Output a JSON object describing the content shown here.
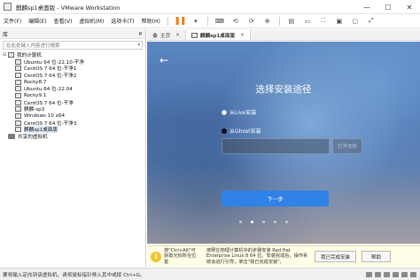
{
  "window": {
    "title": "麒麟sp1桌面版 - VMware Workstation",
    "min": "—",
    "max": "☐",
    "close": "✕"
  },
  "menu": [
    "文件(F)",
    "编辑(E)",
    "查看(V)",
    "虚拟机(M)",
    "选项卡(T)",
    "帮助(H)"
  ],
  "library": {
    "title": "库",
    "close": "✕",
    "search_placeholder": "在此处键入内容进行搜索",
    "root": "我的计算机",
    "vms": [
      "Ubuntu 64 位-22.10-干净",
      "CentOS 7 64 位-干净1",
      "CentOS 7 64 位-干净2",
      "Rocky8.7",
      "Ubuntu 64 位-22.04",
      "Rocky9.1",
      "CentOS 7 64 位-干净",
      "麒麟-sp3",
      "Windows 10 x64",
      "CentOS 7 64 位-干净3",
      "麒麟sp1桌面版"
    ],
    "shared": "共享的虚拟机"
  },
  "tabs": [
    {
      "label": "主页",
      "close": "✕"
    },
    {
      "label": "麒麟sp1桌面版",
      "close": "✕"
    }
  ],
  "installer": {
    "back": "←",
    "title": "选择安装途径",
    "option_live": "从Live安装",
    "option_ghost": "从Ghost安装",
    "open_file": "打开文件",
    "next": "下一步"
  },
  "notification": {
    "icon": "i",
    "hint": "按\"Ctrl+Alt\"可获取光标所在位置",
    "message": "按照在物理计算机中的步骤安装 Red Hat Enterprise Linux 8 64 位。安装完成后，操作系统会进行引导，单击\"我已完成安装\"。",
    "done_button": "我已完成安装",
    "help_button": "帮助"
  },
  "status": "要将输入定向到该虚拟机，请将鼠标指针移入其中或按 Ctrl+G。",
  "colors": {
    "accent": "#2f82e6",
    "pause": "#f07a18",
    "notice_bg": "#fffde6"
  }
}
